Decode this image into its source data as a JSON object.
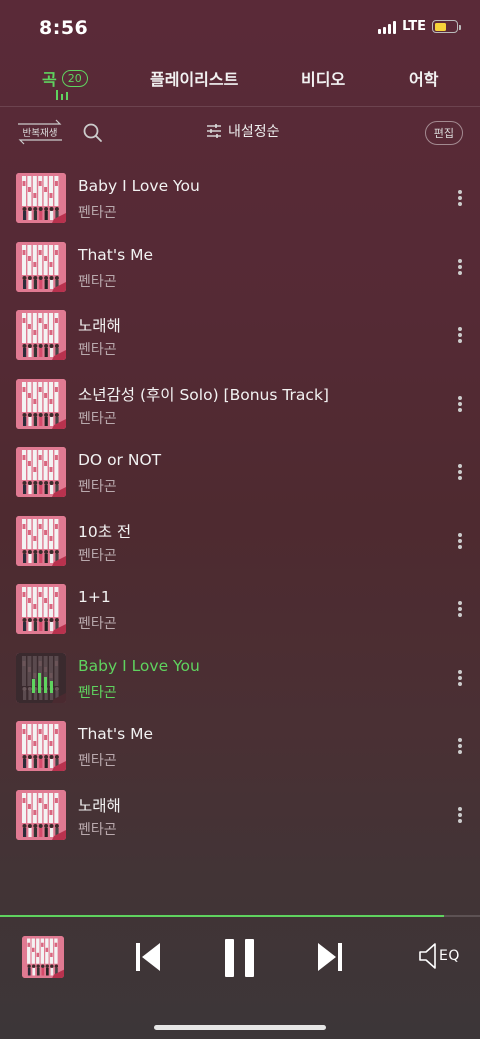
{
  "status_bar": {
    "time": "8:56",
    "network": "LTE"
  },
  "tabs": [
    {
      "label": "곡",
      "count": "20",
      "active": true
    },
    {
      "label": "플레이리스트"
    },
    {
      "label": "비디오"
    },
    {
      "label": "어학"
    }
  ],
  "toolbar": {
    "repeat_label": "반복재생",
    "sort_label": "내설정순",
    "edit_label": "편집"
  },
  "songs": [
    {
      "title": "Baby I Love You",
      "artist": "펜타곤"
    },
    {
      "title": "That's Me",
      "artist": "펜타곤"
    },
    {
      "title": "노래해",
      "artist": "펜타곤"
    },
    {
      "title": "소년감성 (후이 Solo) [Bonus Track]",
      "artist": "펜타곤"
    },
    {
      "title": "DO or NOT",
      "artist": "펜타곤"
    },
    {
      "title": "10초 전",
      "artist": "펜타곤"
    },
    {
      "title": "1+1",
      "artist": "펜타곤"
    },
    {
      "title": "Baby I Love You",
      "artist": "펜타곤",
      "playing": true
    },
    {
      "title": "That's Me",
      "artist": "펜타곤"
    },
    {
      "title": "노래해",
      "artist": "펜타곤"
    }
  ],
  "player": {
    "eq_label": "EQ",
    "progress": 0.925
  },
  "colors": {
    "accent": "#5fd35f",
    "background_top": "#5a2a38",
    "background_bottom": "#3c3638",
    "album_pink": "#e07a92"
  },
  "icons": {
    "search": "search-icon",
    "sort": "sliders-icon",
    "more": "more-vertical-icon",
    "prev": "skip-previous-icon",
    "pause": "pause-icon",
    "next": "skip-next-icon",
    "eq": "speaker-icon"
  }
}
